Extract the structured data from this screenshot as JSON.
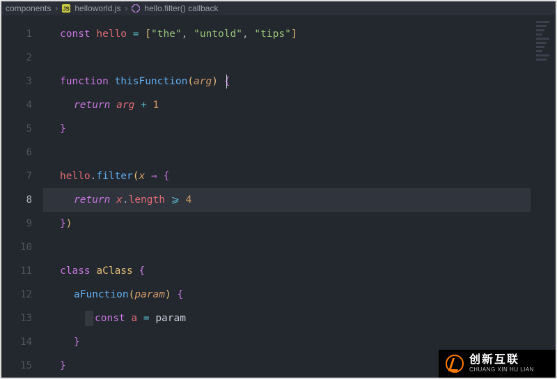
{
  "breadcrumbs": {
    "folder": "components",
    "file": "helloworld.js",
    "symbol": "hello.filter() callback"
  },
  "gutter": {
    "numbers": [
      "1",
      "2",
      "3",
      "4",
      "5",
      "6",
      "7",
      "8",
      "9",
      "10",
      "11",
      "12",
      "13",
      "14",
      "15"
    ],
    "currentLine": 8
  },
  "cursor": {
    "line": 3,
    "afterText": "arg"
  },
  "code": {
    "l1": {
      "const": "const",
      "name": "hello",
      "eq": "=",
      "lb": "[",
      "s1": "\"the\"",
      "c": ",",
      "s2": "\"untold\"",
      "s3": "\"tips\"",
      "rb": "]"
    },
    "l3": {
      "function": "function",
      "name": "thisFunction",
      "lp": "(",
      "param": "arg",
      "rp": ")",
      "lb": "{"
    },
    "l4": {
      "return": "return",
      "arg": "arg",
      "plus": "+",
      "one": "1"
    },
    "l5": {
      "rb": "}"
    },
    "l7": {
      "obj": "hello",
      "dot": ".",
      "fn": "filter",
      "lp": "(",
      "x": "x",
      "arrow": "⇒",
      "lb": "{"
    },
    "l8": {
      "return": "return",
      "x": "x",
      "dot": ".",
      "prop": "length",
      "gte": "⩾",
      "four": "4"
    },
    "l9": {
      "rb": "}",
      "rp": ")"
    },
    "l11": {
      "class": "class",
      "name": "aClass",
      "lb": "{"
    },
    "l12": {
      "fn": "aFunction",
      "lp": "(",
      "param": "param",
      "rp": ")",
      "lb": "{"
    },
    "l13": {
      "const": "const",
      "name": "a",
      "eq": "=",
      "param": "param"
    },
    "l14": {
      "rb": "}"
    },
    "l15": {
      "rb": "}"
    }
  },
  "watermark": {
    "cn": "创新互联",
    "en": "CHUANG XIN HU LIAN"
  }
}
